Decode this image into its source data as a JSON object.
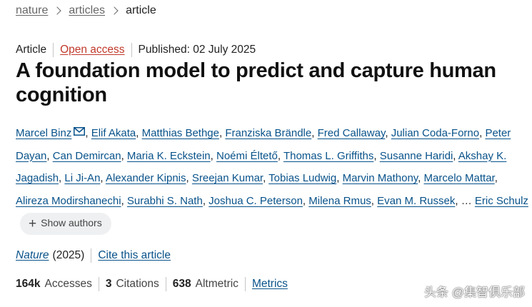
{
  "breadcrumb": [
    {
      "label": "nature"
    },
    {
      "label": "articles"
    },
    {
      "label": "article"
    }
  ],
  "meta": {
    "type": "Article",
    "access": "Open access",
    "published": "Published: 02 July 2025"
  },
  "title": "A foundation model to predict and capture human cognition",
  "authors": [
    "Marcel Binz",
    "Elif Akata",
    "Matthias Bethge",
    "Franziska Brändle",
    "Fred Callaway",
    "Julian Coda-Forno",
    "Peter Dayan",
    "Can Demircan",
    "Maria K. Eckstein",
    "Noémi Éltető",
    "Thomas L. Griffiths",
    "Susanne Haridi",
    "Akshay K. Jagadish",
    "Li Ji-An",
    "Alexander Kipnis",
    "Sreejan Kumar",
    "Tobias Ludwig",
    "Marvin Mathony",
    "Marcelo Mattar",
    "Alireza Modirshanechi",
    "Surabhi S. Nath",
    "Joshua C. Peterson",
    "Milena Rmus",
    "Evan M. Russek",
    "Eric Schulz"
  ],
  "ellipsis": "…",
  "show_authors": "Show authors",
  "journal": {
    "name": "Nature",
    "year": "(2025)",
    "cite": "Cite this article"
  },
  "metrics": {
    "accesses_value": "164k",
    "accesses_label": "Accesses",
    "citations_value": "3",
    "citations_label": "Citations",
    "altmetric_value": "638",
    "altmetric_label": "Altmetric",
    "metrics_link": "Metrics"
  },
  "watermark": "头条 @集智俱乐部",
  "icons": {
    "mail": "mail-icon",
    "plus": "plus-icon",
    "chevron": "chevron-right-icon"
  },
  "colors": {
    "link": "#08528a",
    "open_access": "#c0392b",
    "text": "#222222"
  }
}
